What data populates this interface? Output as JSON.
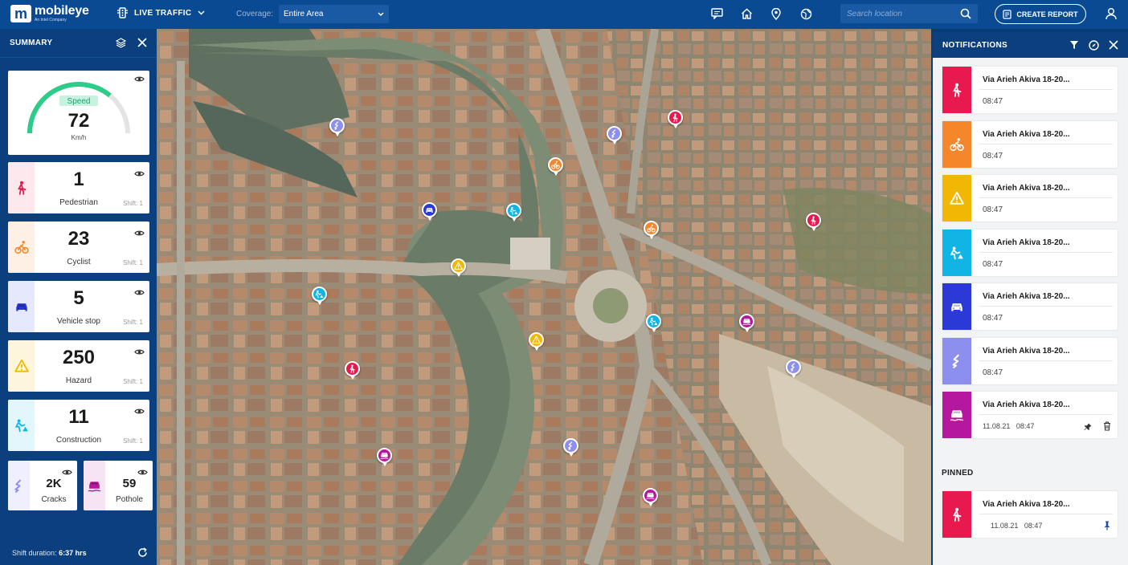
{
  "app": {
    "name": "mobileye",
    "sub": "An Intel Company"
  },
  "topbar": {
    "mode": "LIVE TRAFFIC",
    "coverage_label": "Coverage:",
    "coverage_value": "Entire Area",
    "search_placeholder": "Search location",
    "create_report": "CREATE REPORT",
    "icons": [
      "chat-icon",
      "home-icon",
      "location-pin-icon",
      "globe-icon"
    ]
  },
  "sidebar": {
    "title": "SUMMARY",
    "speed": {
      "label": "Speed",
      "value": "72",
      "unit": "Km/h",
      "gauge_fraction": 0.72
    },
    "metrics": [
      {
        "value": "1",
        "label": "Pedestrian",
        "shift": "Shift: 1",
        "color": "#e8194f",
        "bg": "#fde8ee",
        "icon": "pedestrian-icon"
      },
      {
        "value": "23",
        "label": "Cyclist",
        "shift": "Shift: 1",
        "color": "#f5862a",
        "bg": "#fef0e4",
        "icon": "cyclist-icon"
      },
      {
        "value": "5",
        "label": "Vehicle stop",
        "shift": "Shift: 1",
        "color": "#2b3ad6",
        "bg": "#e6e8fb",
        "icon": "vehicle-icon"
      },
      {
        "value": "250",
        "label": "Hazard",
        "shift": "Shift: 1",
        "color": "#f2b705",
        "bg": "#fdf5dc",
        "icon": "hazard-icon"
      },
      {
        "value": "11",
        "label": "Construction",
        "shift": "Shift: 1",
        "color": "#10b5e5",
        "bg": "#e2f6fc",
        "icon": "construction-icon"
      }
    ],
    "mini": [
      {
        "value": "2K",
        "label": "Cracks",
        "color": "#8d8fef",
        "bg": "#efeffd",
        "icon": "cracks-icon"
      },
      {
        "value": "59",
        "label": "Pothole",
        "color": "#b5179e",
        "bg": "#f7e4f3",
        "icon": "pothole-icon"
      }
    ],
    "shift_label": "Shift duration:",
    "shift_value": "6:37 hrs"
  },
  "notifications": {
    "title": "NOTIFICATIONS",
    "items": [
      {
        "title": "Via Arieh Akiva 18-20...",
        "time": "08:47",
        "color": "#e8194f",
        "icon": "pedestrian-icon"
      },
      {
        "title": "Via Arieh Akiva 18-20...",
        "time": "08:47",
        "color": "#f5862a",
        "icon": "cyclist-icon"
      },
      {
        "title": "Via Arieh Akiva 18-20...",
        "time": "08:47",
        "color": "#f2b705",
        "icon": "hazard-icon"
      },
      {
        "title": "Via Arieh Akiva 18-20...",
        "time": "08:47",
        "color": "#10b5e5",
        "icon": "construction-icon"
      },
      {
        "title": "Via Arieh Akiva 18-20...",
        "time": "08:47",
        "color": "#2b3ad6",
        "icon": "vehicle-icon"
      },
      {
        "title": "Via Arieh Akiva 18-20...",
        "time": "08:47",
        "color": "#8d8fef",
        "icon": "cracks-icon"
      },
      {
        "title": "Via Arieh Akiva 18-20...",
        "date": "11.08.21",
        "time": "08:47",
        "color": "#b5179e",
        "icon": "pothole-icon"
      }
    ],
    "pinned_label": "PINNED",
    "pinned": [
      {
        "title": "Via Arieh Akiva 18-20...",
        "date": "11.08.21",
        "time": "08:47",
        "color": "#e8194f",
        "icon": "pedestrian-icon"
      }
    ]
  },
  "map": {
    "pins": [
      {
        "type": "cracks",
        "color": "#8d8fef"
      },
      {
        "type": "cracks",
        "color": "#8d8fef"
      },
      {
        "type": "pedestrian",
        "color": "#e8194f"
      },
      {
        "type": "cyclist",
        "color": "#f5862a"
      },
      {
        "type": "vehicle",
        "color": "#2b3ad6"
      },
      {
        "type": "construction",
        "color": "#10b5e5"
      },
      {
        "type": "pedestrian",
        "color": "#e8194f"
      },
      {
        "type": "cyclist",
        "color": "#f5862a"
      },
      {
        "type": "hazard",
        "color": "#f2b705"
      },
      {
        "type": "construction",
        "color": "#10b5e5"
      },
      {
        "type": "construction",
        "color": "#10b5e5"
      },
      {
        "type": "pothole",
        "color": "#b5179e"
      },
      {
        "type": "hazard",
        "color": "#f2b705"
      },
      {
        "type": "pedestrian",
        "color": "#e8194f"
      },
      {
        "type": "cracks",
        "color": "#8d8fef"
      },
      {
        "type": "cracks",
        "color": "#8d8fef"
      },
      {
        "type": "pothole",
        "color": "#b5179e"
      },
      {
        "type": "pothole",
        "color": "#b5179e"
      }
    ]
  }
}
